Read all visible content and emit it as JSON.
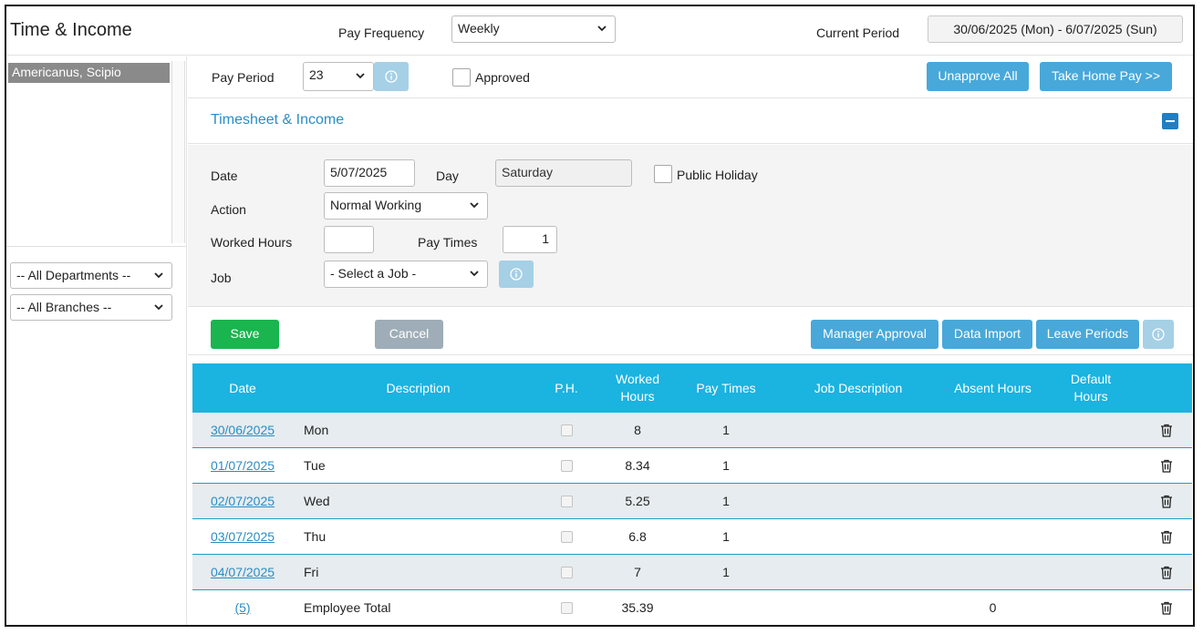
{
  "header": {
    "title": "Time & Income",
    "pay_frequency_label": "Pay Frequency",
    "pay_frequency_value": "Weekly",
    "current_period_label": "Current Period",
    "current_period_value": "30/06/2025 (Mon) - 6/07/2025 (Sun)"
  },
  "sidebar": {
    "selected_employee": "Americanus, Scipio",
    "department_filter": "-- All Departments --",
    "branch_filter": "-- All Branches --"
  },
  "pay_period": {
    "label": "Pay Period",
    "value": "23",
    "approved_label": "Approved",
    "unapprove_all": "Unapprove All",
    "take_home_pay": "Take Home Pay >>"
  },
  "section": {
    "title": "Timesheet & Income"
  },
  "form": {
    "date_label": "Date",
    "date_value": "5/07/2025",
    "day_label": "Day",
    "day_value": "Saturday",
    "public_holiday_label": "Public Holiday",
    "action_label": "Action",
    "action_value": "Normal Working",
    "worked_hours_label": "Worked Hours",
    "worked_hours_value": "",
    "pay_times_label": "Pay Times",
    "pay_times_value": "1",
    "job_label": "Job",
    "job_value": "- Select a Job -"
  },
  "actions": {
    "save": "Save",
    "cancel": "Cancel",
    "manager_approval": "Manager Approval",
    "data_import": "Data Import",
    "leave_periods": "Leave Periods"
  },
  "table": {
    "headers": {
      "date": "Date",
      "description": "Description",
      "ph": "P.H.",
      "worked_hours_1": "Worked",
      "worked_hours_2": "Hours",
      "pay_times": "Pay Times",
      "job_description": "Job Description",
      "absent_hours": "Absent Hours",
      "default_hours_1": "Default",
      "default_hours_2": "Hours"
    },
    "rows": [
      {
        "date": "30/06/2025",
        "description": "Mon",
        "worked_hours": "8",
        "pay_times": "1",
        "absent_hours": ""
      },
      {
        "date": "01/07/2025",
        "description": "Tue",
        "worked_hours": "8.34",
        "pay_times": "1",
        "absent_hours": ""
      },
      {
        "date": "02/07/2025",
        "description": "Wed",
        "worked_hours": "5.25",
        "pay_times": "1",
        "absent_hours": ""
      },
      {
        "date": "03/07/2025",
        "description": "Thu",
        "worked_hours": "6.8",
        "pay_times": "1",
        "absent_hours": ""
      },
      {
        "date": "04/07/2025",
        "description": "Fri",
        "worked_hours": "7",
        "pay_times": "1",
        "absent_hours": ""
      }
    ],
    "total": {
      "date": "(5)",
      "description": "Employee Total",
      "worked_hours": "35.39",
      "pay_times": "",
      "absent_hours": "0"
    }
  },
  "colors": {
    "accent": "#48a8d9",
    "table_header": "#1bb3e0",
    "save": "#1ab54e",
    "cancel": "#9eadb7",
    "link": "#2a8dc5"
  },
  "icons": {
    "dropdown": "chevron-down-icon",
    "info": "info-icon",
    "delete": "trash-icon",
    "collapse": "minus-icon"
  }
}
